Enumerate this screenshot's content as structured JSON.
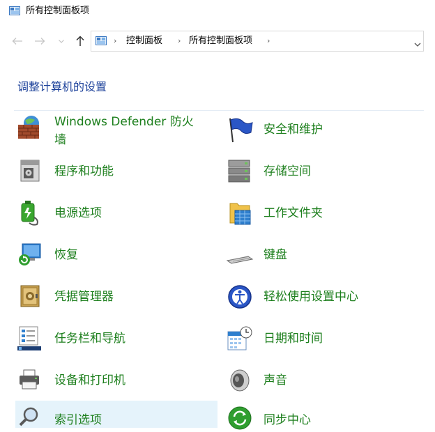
{
  "window": {
    "title": "所有控制面板项",
    "icon": "control-panel-icon"
  },
  "navigation": {
    "back_icon": "arrow-left-icon",
    "forward_icon": "arrow-right-icon",
    "recent_icon": "chevron-down-icon",
    "up_icon": "arrow-up-icon",
    "breadcrumb": [
      "控制面板",
      "所有控制面板项"
    ],
    "breadcrumb_separator": "›"
  },
  "main": {
    "heading": "调整计算机的设置",
    "items": [
      {
        "label": "Windows Defender 防火",
        "label_line2": "墙",
        "icon": "firewall-icon"
      },
      {
        "label": "安全和维护",
        "icon": "security-flag-icon"
      },
      {
        "label": "程序和功能",
        "icon": "programs-icon"
      },
      {
        "label": "存储空间",
        "icon": "storage-spaces-icon"
      },
      {
        "label": "电源选项",
        "icon": "power-options-icon"
      },
      {
        "label": "工作文件夹",
        "icon": "work-folders-icon"
      },
      {
        "label": "恢复",
        "icon": "recovery-icon"
      },
      {
        "label": "键盘",
        "icon": "keyboard-icon"
      },
      {
        "label": "凭据管理器",
        "icon": "credential-safe-icon"
      },
      {
        "label": "轻松使用设置中心",
        "icon": "ease-of-access-icon"
      },
      {
        "label": "任务栏和导航",
        "icon": "taskbar-icon"
      },
      {
        "label": "日期和时间",
        "icon": "date-time-icon"
      },
      {
        "label": "设备和打印机",
        "icon": "printer-icon"
      },
      {
        "label": "声音",
        "icon": "speaker-icon"
      },
      {
        "label": "索引选项",
        "icon": "indexing-icon"
      },
      {
        "label": "同步中心",
        "icon": "sync-center-icon"
      }
    ]
  },
  "colors": {
    "link": "#1d7f1d",
    "heading": "#1a3f99",
    "hover": "#e5f3fb",
    "divider": "#e3ecf5"
  }
}
